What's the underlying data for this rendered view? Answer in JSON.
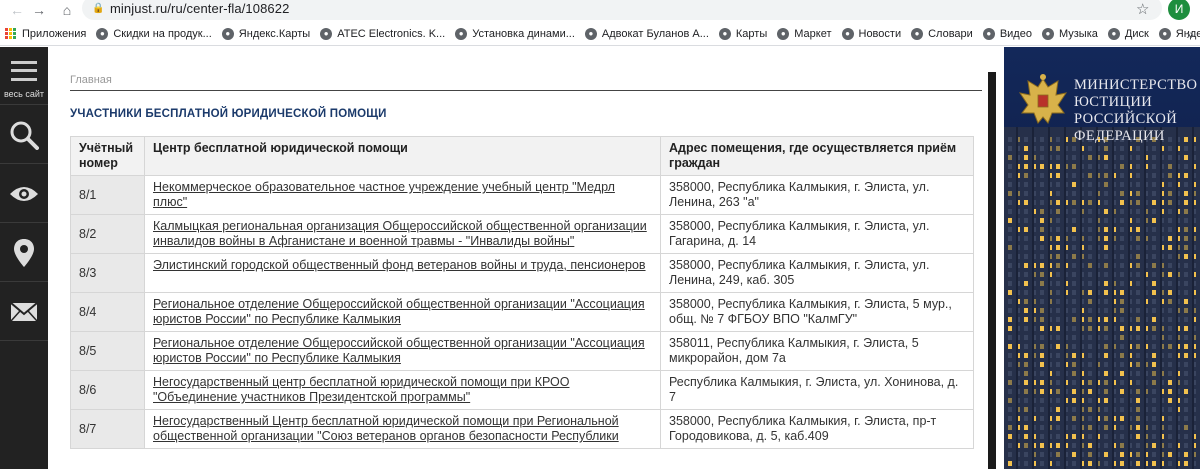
{
  "browser": {
    "url": "minjust.ru/ru/center-fla/108622",
    "profile_initial": "И"
  },
  "bookmarks": [
    {
      "label": "Приложения",
      "icon": "apps-grid-icon"
    },
    {
      "label": "Скидки на продук...",
      "icon": "globe-icon"
    },
    {
      "label": "Яндекс.Карты",
      "icon": "globe-icon"
    },
    {
      "label": "ATEC Electronics. K...",
      "icon": "globe-icon"
    },
    {
      "label": "Установка динами...",
      "icon": "globe-icon"
    },
    {
      "label": "Адвокат Буланов А...",
      "icon": "globe-icon"
    },
    {
      "label": "Карты",
      "icon": "globe-icon"
    },
    {
      "label": "Маркет",
      "icon": "globe-icon"
    },
    {
      "label": "Новости",
      "icon": "globe-icon"
    },
    {
      "label": "Словари",
      "icon": "globe-icon"
    },
    {
      "label": "Видео",
      "icon": "globe-icon"
    },
    {
      "label": "Музыка",
      "icon": "globe-icon"
    },
    {
      "label": "Диск",
      "icon": "globe-icon"
    },
    {
      "label": "Яндекс",
      "icon": "globe-icon"
    }
  ],
  "sidebar": {
    "menu_label": "весь сайт",
    "items": [
      "menu-icon",
      "search-icon",
      "eye-icon",
      "location-pin-icon",
      "envelope-icon"
    ]
  },
  "breadcrumb": "Главная",
  "section_title": "УЧАСТНИКИ БЕСПЛАТНОЙ ЮРИДИЧЕСКОЙ ПОМОЩИ",
  "table": {
    "headers": [
      "Учётный номер",
      "Центр бесплатной юридической помощи",
      "Адрес помещения, где осуществляется приём граждан"
    ],
    "rows": [
      {
        "num": "8/1",
        "center": "Некоммерческое образовательное частное учреждение учебный центр \"Медрл плюс\"",
        "address": "358000, Республика Калмыкия, г. Элиста, ул. Ленина, 263 \"а\""
      },
      {
        "num": "8/2",
        "center": "Калмыцкая региональная организация Общероссийской общественной организации инвалидов войны в Афганистане и военной травмы - \"Инвалиды войны\"",
        "address": "358000, Республика Калмыкия, г. Элиста, ул. Гагарина, д. 14"
      },
      {
        "num": "8/3",
        "center": "Элистинский городской общественный фонд ветеранов войны и труда, пенсионеров",
        "address": "358000, Республика Калмыкия, г. Элиста, ул. Ленина, 249, каб. 305"
      },
      {
        "num": "8/4",
        "center": "Региональное отделение Общероссийской общественной организации \"Ассоциация юристов России\" по Республике Калмыкия",
        "address": "358000, Республика Калмыкия, г. Элиста, 5 мур., общ. № 7 ФГБОУ ВПО \"КалмГУ\""
      },
      {
        "num": "8/5",
        "center": "Региональное отделение Общероссийской общественной организации \"Ассоциация юристов России\" по Республике Калмыкия",
        "address": "358011, Республика Калмыкия, г. Элиста, 5 микрорайон, дом 7а"
      },
      {
        "num": "8/6",
        "center": "Негосударственный центр бесплатной юридической помощи при КРОО \"Объединение участников Президентской программы\"",
        "address": "Республика Калмыкия, г. Элиста, ул. Хонинова, д. 7"
      },
      {
        "num": "8/7",
        "center": "Негосударственный Центр бесплатной юридической помощи при Региональной общественной организации \"Союз ветеранов органов безопасности Республики",
        "address": "358000, Республика Калмыкия, г. Элиста, пр-т Городовикова, д. 5, каб.409"
      }
    ]
  },
  "banner": {
    "lines": [
      "МИНИСТЕРСТВО",
      "ЮСТИЦИИ",
      "РОССИЙСКОЙ",
      "ФЕДЕРАЦИИ"
    ]
  }
}
